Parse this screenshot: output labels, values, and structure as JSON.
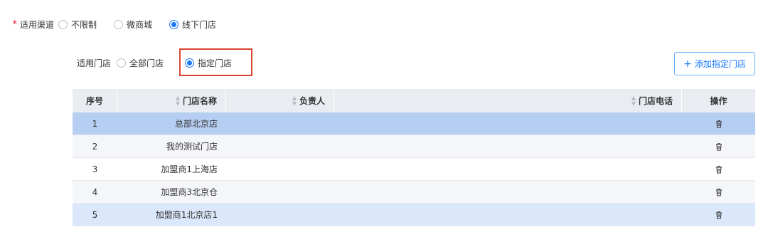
{
  "channel": {
    "required_mark": "*",
    "label": "适用渠道",
    "options": [
      {
        "label": "不限制",
        "checked": false
      },
      {
        "label": "微商城",
        "checked": false
      },
      {
        "label": "线下门店",
        "checked": true
      }
    ]
  },
  "store_scope": {
    "label": "适用门店",
    "options": [
      {
        "label": "全部门店",
        "checked": false
      },
      {
        "label": "指定门店",
        "checked": true
      }
    ]
  },
  "add_button": {
    "plus": "+",
    "label": "添加指定门店"
  },
  "table": {
    "headers": {
      "seq": "序号",
      "name": "门店名称",
      "owner": "负责人",
      "phone": "门店电话",
      "op": "操作"
    },
    "rows": [
      {
        "seq": "1",
        "name": "总部北京店",
        "owner": "",
        "phone": ""
      },
      {
        "seq": "2",
        "name": "我的测试门店",
        "owner": "",
        "phone": ""
      },
      {
        "seq": "3",
        "name": "加盟商1上海店",
        "owner": "",
        "phone": ""
      },
      {
        "seq": "4",
        "name": "加盟商3北京仓",
        "owner": "",
        "phone": ""
      },
      {
        "seq": "5",
        "name": "加盟商1北京店1",
        "owner": "",
        "phone": ""
      }
    ]
  },
  "colors": {
    "accent": "#1677ff",
    "highlight_border": "#d9452f",
    "selected_row": "#b7cef3"
  }
}
